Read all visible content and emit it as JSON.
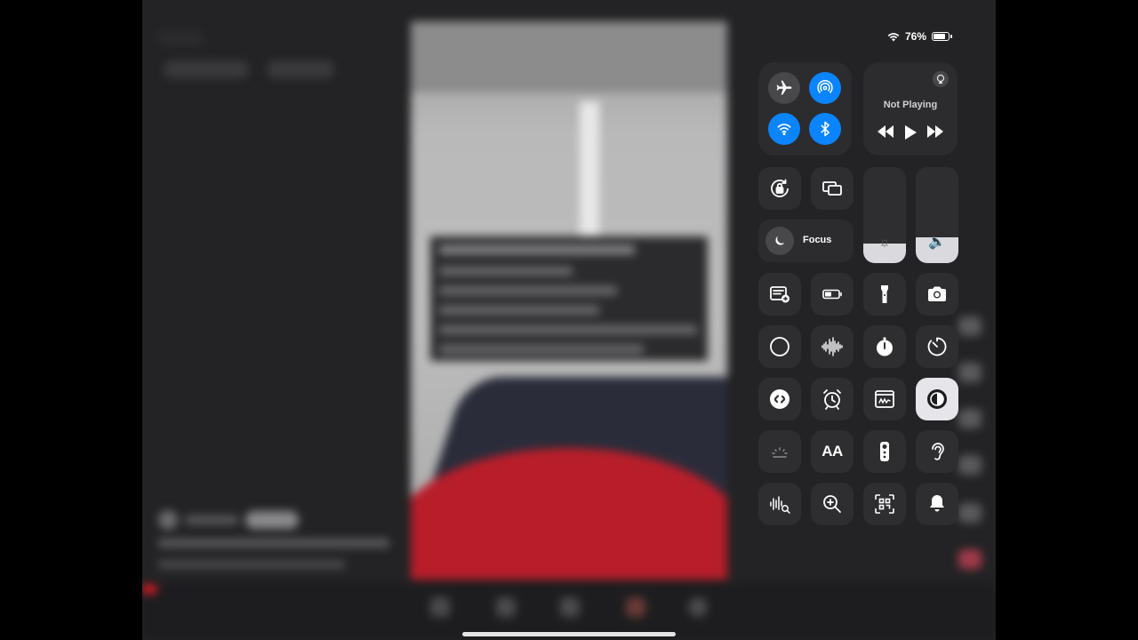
{
  "status_bar": {
    "battery_percent": "76%",
    "battery_level": 0.76
  },
  "media": {
    "title": "Not Playing"
  },
  "focus": {
    "label": "Focus"
  },
  "sliders": {
    "brightness_level": 0.2,
    "volume_level": 0.27
  },
  "connectivity": [
    {
      "name": "airplane-mode",
      "active": false
    },
    {
      "name": "airdrop",
      "active": true
    },
    {
      "name": "wifi",
      "active": true
    },
    {
      "name": "bluetooth",
      "active": true
    }
  ],
  "text_size_label": "AA",
  "colors": {
    "accent": "#0a84ff",
    "tile": "#2e2e30",
    "tile_active": "#e5e5ea",
    "background": "#232325"
  }
}
